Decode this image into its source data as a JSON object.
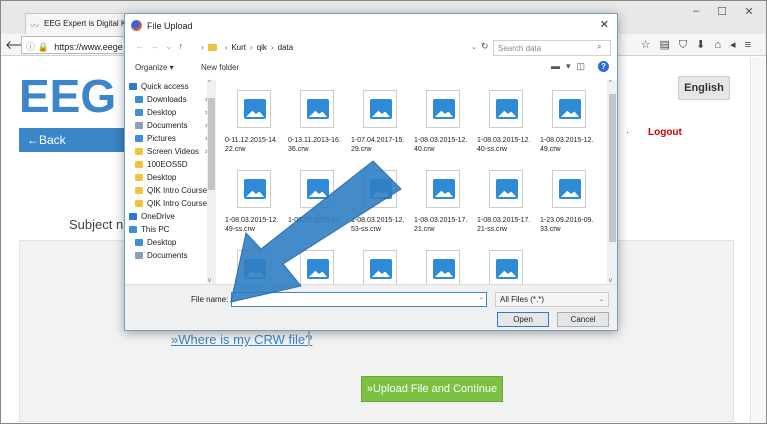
{
  "browser": {
    "tab_title": "EEG Expert is Digital Knowle",
    "url": "https://www.eege",
    "window_controls": [
      "–",
      "☐",
      "✕"
    ],
    "toolbar_icons": [
      "☆",
      "▤",
      "⛉",
      "⬇",
      "⌂",
      "◂",
      "≡"
    ]
  },
  "page": {
    "logo_text": "EEG E",
    "language_button": "English",
    "back_button": "←Back",
    "logout": "Logout",
    "subject_label": "Subject nu",
    "crw_link": "»Where is my CRW file?",
    "continue_button": "»Upload File and Continue"
  },
  "dialog": {
    "title": "File Upload",
    "close": "✕",
    "nav_arrows": [
      "←",
      "→",
      "⌄",
      "↑"
    ],
    "breadcrumb": [
      "Kurt",
      "qik",
      "data"
    ],
    "search_placeholder": "Search data",
    "organize": "Organize ▾",
    "new_folder": "New folder",
    "nav_items": [
      {
        "label": "Quick access",
        "icon": "star-icon",
        "color": "#2f78d6",
        "pinned": false
      },
      {
        "label": "Downloads",
        "icon": "download-folder-icon",
        "color": "#3f8fd8",
        "pinned": true
      },
      {
        "label": "Desktop",
        "icon": "desktop-folder-icon",
        "color": "#3f8fd8",
        "pinned": true
      },
      {
        "label": "Documents",
        "icon": "documents-folder-icon",
        "color": "#8aa0b8",
        "pinned": true
      },
      {
        "label": "Pictures",
        "icon": "pictures-folder-icon",
        "color": "#3f8fd8",
        "pinned": true
      },
      {
        "label": "Screen Videos",
        "icon": "folder-icon",
        "color": "#f2c33c",
        "pinned": true
      },
      {
        "label": "100EOS5D",
        "icon": "folder-icon",
        "color": "#f2c33c",
        "pinned": false
      },
      {
        "label": "Desktop",
        "icon": "folder-icon",
        "color": "#f2c33c",
        "pinned": false
      },
      {
        "label": "QIK Intro Course",
        "icon": "folder-icon",
        "color": "#f2c33c",
        "pinned": false
      },
      {
        "label": "QIK Intro Course",
        "icon": "folder-icon",
        "color": "#f2c33c",
        "pinned": false
      },
      {
        "label": "OneDrive",
        "icon": "cloud-icon",
        "color": "#2f78d6",
        "pinned": false
      },
      {
        "label": "This PC",
        "icon": "computer-icon",
        "color": "#3f8fd8",
        "pinned": false
      },
      {
        "label": "Desktop",
        "icon": "desktop-folder-icon",
        "color": "#3f8fd8",
        "pinned": false
      },
      {
        "label": "Documents",
        "icon": "documents-folder-icon",
        "color": "#8aa0b8",
        "pinned": false
      }
    ],
    "files": [
      [
        "0-11.12.2015-14.",
        "22.crw"
      ],
      [
        "0-13.11.2013-16.",
        "36.crw"
      ],
      [
        "1-07.04.2017-15.",
        "29.crw"
      ],
      [
        "1-08.03.2015-12.",
        "40.crw"
      ],
      [
        "1-08.03.2015-12.",
        "40-ss.crw"
      ],
      [
        "1-08.03.2015-12.",
        "49.crw"
      ],
      [
        "1-08.03.2015-12.",
        "49-ss.crw"
      ],
      [
        "1-08.03.2015-12.",
        ""
      ],
      [
        "1-08.03.2015-12.",
        "53-ss.crw"
      ],
      [
        "1-08.03.2015-17.",
        "21.crw"
      ],
      [
        "1-08.03.2015-17.",
        "21-ss.crw"
      ],
      [
        "1-23.09.2016-09.",
        "33.crw"
      ],
      [
        "",
        ""
      ],
      [
        "",
        ""
      ],
      [
        "",
        ""
      ],
      [
        "",
        ""
      ],
      [
        "",
        ""
      ]
    ],
    "file_name_label": "File name:",
    "file_name_value": "",
    "file_type": "All Files (*.*)",
    "open_button": "Open",
    "cancel_button": "Cancel"
  },
  "annotation": {
    "type": "arrow",
    "color": "#2f7fc4"
  }
}
